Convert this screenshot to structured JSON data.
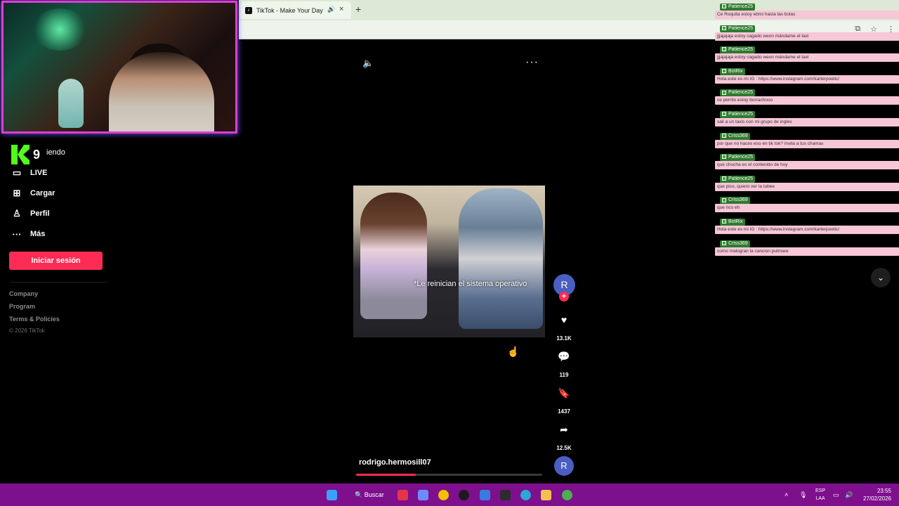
{
  "browser": {
    "tab_title": "TikTok - Make Your Day",
    "new_tab_icon": "plus-icon"
  },
  "overlay": {
    "logo_number": "9",
    "logo_text": "iendo"
  },
  "nav": {
    "items": [
      {
        "label": "LIVE",
        "icon": "live-tv-icon"
      },
      {
        "label": "Cargar",
        "icon": "upload-icon"
      },
      {
        "label": "Perfil",
        "icon": "profile-icon"
      },
      {
        "label": "Más",
        "icon": "more-dots-icon"
      }
    ],
    "login_label": "Iniciar sesión",
    "footer_links": [
      "Company",
      "Program",
      "Terms & Policies"
    ],
    "copyright": "© 2026 TikTok"
  },
  "video": {
    "caption": "*Le reinician el sistema operativo",
    "author": "rodrigo.hermosill07",
    "progress": 0.32,
    "avatar_initial": "R",
    "likes": "13.1K",
    "comments": "119",
    "saves": "1437",
    "shares": "12.5K"
  },
  "chat": {
    "messages": [
      {
        "user": "Patience25",
        "text": "Ce Roquita estoy ebrio hasta las bolas"
      },
      {
        "user": "Patience25",
        "text": "jjjajajaja estoy cagado weon mándame el taxi"
      },
      {
        "user": "Patience25",
        "text": "jjjajajaja estoy cagado weon mándame el taxi"
      },
      {
        "user": "BotRix",
        "text": "Hola este es mi IG : https://www.instagram.com/karterpoetic/"
      },
      {
        "user": "Patience25",
        "text": "ce perrito estoy borrachooo"
      },
      {
        "user": "Patience25",
        "text": "sali a un taxis con mi grupo de ingles"
      },
      {
        "user": "Criss369",
        "text": "por que no haces eso en tik tok? invita a tus chamas"
      },
      {
        "user": "Patience25",
        "text": "que chucha es el contenido de hoy"
      },
      {
        "user": "Patience25",
        "text": "que pico, quiero ver la tubee"
      },
      {
        "user": "Criss369",
        "text": "que rico eh"
      },
      {
        "user": "BotRix",
        "text": "Hola este es mi IG : https://www.instagram.com/karterpoetic/"
      },
      {
        "user": "Criss369",
        "text": "como malogran la cancion putmare"
      }
    ]
  },
  "taskbar": {
    "search_label": "Buscar",
    "lang_top": "ESP",
    "lang_bottom": "LAA",
    "time": "23:55",
    "date": "27/02/2026"
  },
  "colors": {
    "brand_pink": "#fe2c55",
    "taskbar": "#7e0f8d",
    "chat_bg": "#f7c6d7",
    "webcam_border": "#e13cd2"
  }
}
